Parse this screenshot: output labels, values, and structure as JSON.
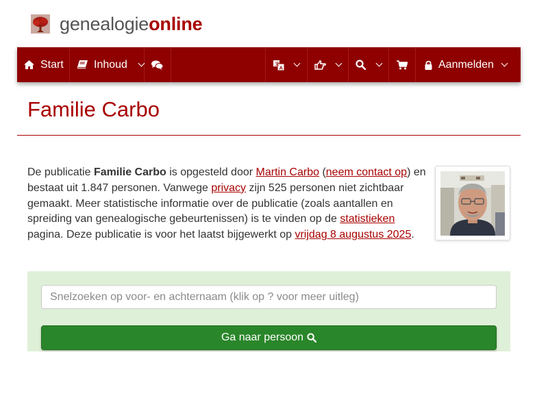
{
  "logo": {
    "part1": "genealogie",
    "part2": "online"
  },
  "nav": {
    "start_label": "Start",
    "inhoud_label": "Inhoud",
    "aanmelden_label": "Aanmelden"
  },
  "page": {
    "title": "Familie Carbo"
  },
  "intro": {
    "t1": "De publicatie ",
    "pub_name": "Familie Carbo",
    "t2": " is opgesteld door ",
    "author_link": "Martin Carbo",
    "t3": " (",
    "contact_link": "neem contact op",
    "t4": ") en bestaat uit 1.847 personen. Vanwege ",
    "privacy_link": "privacy",
    "t5": " zijn 525 personen niet zichtbaar gemaakt. Meer statistische informatie over de publicatie (zoals aantallen en spreiding van genealogische gebeurtenissen) is te vinden op de ",
    "stats_link": "statistieken",
    "t6": " pagina. Deze publicatie is voor het laatst bijgewerkt op ",
    "date_link": "vrijdag 8 augustus 2025",
    "t7": "."
  },
  "search": {
    "placeholder": "Snelzoeken op voor- en achternaam (klik op ? voor meer uitleg)",
    "button_label": "Ga naar persoon"
  },
  "icons": {
    "logo": "tree-icon",
    "start": "home-icon",
    "inhoud": "book-icon",
    "forum": "comments-icon",
    "language": "translate-icon",
    "share": "hand-point-icon",
    "search": "search-icon",
    "cart": "shopping-cart-icon",
    "login": "lock-icon"
  },
  "colors": {
    "brand": "#a80000",
    "navbar": "#8f0000",
    "panel": "#dff0d8",
    "button": "#2a862a"
  }
}
